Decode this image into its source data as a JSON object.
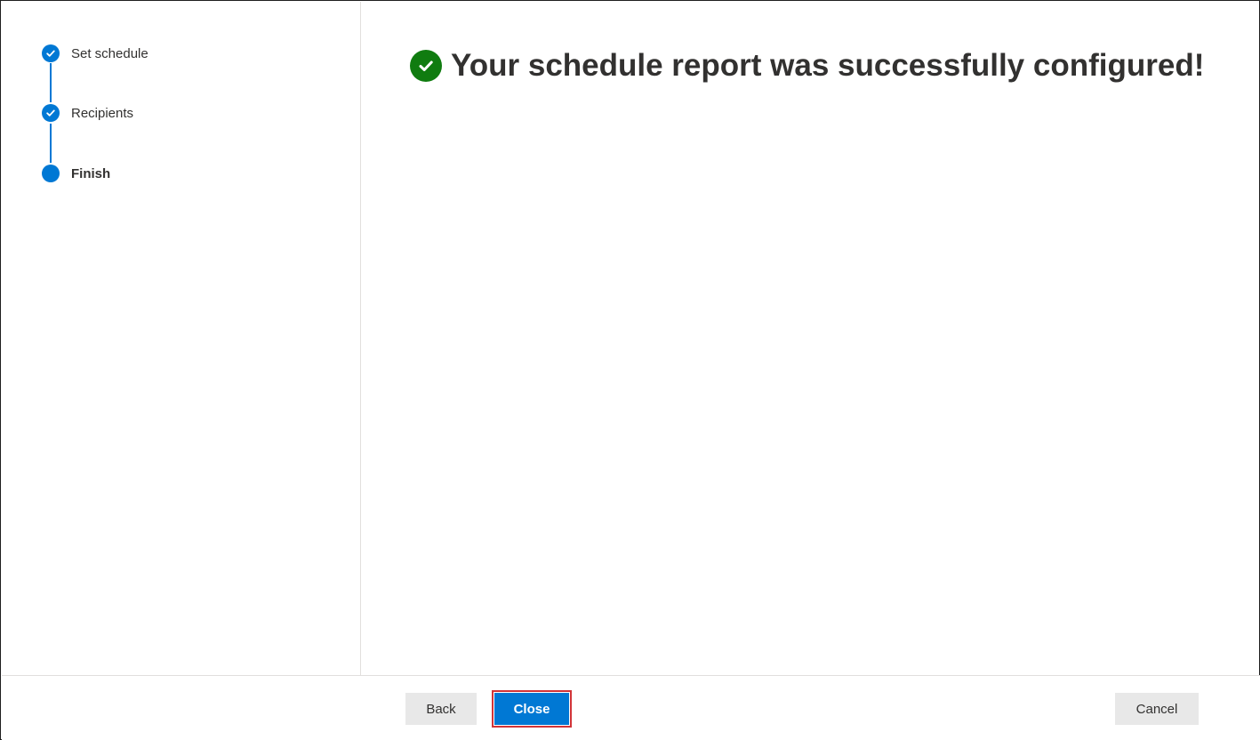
{
  "steps": [
    {
      "label": "Set schedule",
      "status": "completed"
    },
    {
      "label": "Recipients",
      "status": "completed"
    },
    {
      "label": "Finish",
      "status": "current"
    }
  ],
  "main": {
    "headline": "Your schedule report was successfully configured!",
    "success_icon": "checkmark-circle-icon"
  },
  "footer": {
    "back_label": "Back",
    "close_label": "Close",
    "cancel_label": "Cancel"
  },
  "colors": {
    "accent": "#0078d4",
    "success": "#107c10",
    "highlight": "#d13438"
  }
}
